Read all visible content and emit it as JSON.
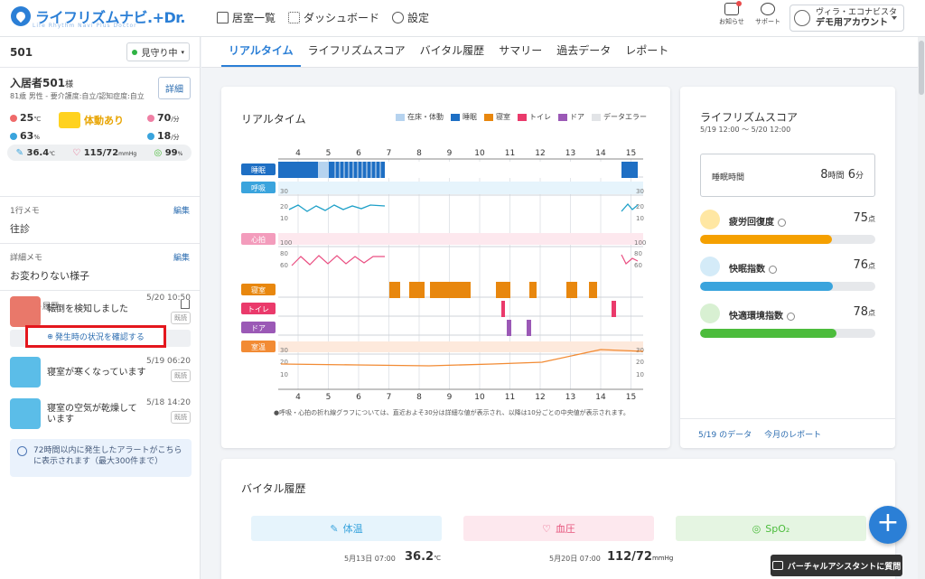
{
  "brand": {
    "name": "ライフリズムナビ.+Dr.",
    "tagline": "Life Rhythm Navi Plus Doctor",
    "accent": "#2b7fd6"
  },
  "topnav": [
    {
      "label": "居室一覧",
      "icon": "home-icon"
    },
    {
      "label": "ダッシュボード",
      "icon": "dashboard-icon"
    },
    {
      "label": "設定",
      "icon": "gear-icon"
    }
  ],
  "header": {
    "notifications_label": "お知らせ",
    "support_label": "サポート"
  },
  "account": {
    "facility": "ヴィラ・エコナビスタ",
    "name": "デモ用アカウント"
  },
  "sidebar": {
    "room_no": "501",
    "watch_status": "見守り中",
    "resident": {
      "name": "入居者501",
      "suffix": "様",
      "info": "81歳 男性 - 要介護度:自立/認知症度:自立",
      "detail_label": "詳細"
    },
    "env": {
      "temp": "25",
      "temp_unit": "℃",
      "humidity": "63",
      "humidity_unit": "%",
      "activity": "体動あり",
      "heart": "70",
      "heart_unit": "/分",
      "resp": "18",
      "resp_unit": "/分"
    },
    "vitals": {
      "body_temp": "36.4",
      "body_temp_unit": "℃",
      "bp": "115/72",
      "bp_unit": "mmHg",
      "spo2": "99",
      "spo2_unit": "%"
    },
    "memo1": {
      "label": "1行メモ",
      "edit": "編集",
      "value": "往診"
    },
    "memo2": {
      "label": "詳細メモ",
      "edit": "編集",
      "value": "お変わりない様子"
    },
    "alerts_label": "アラート履歴",
    "alerts": [
      {
        "text": "転倒を検知しました",
        "time": "5/20 10:50",
        "badge": "既読",
        "color": "#e9786a"
      },
      {
        "text": "寝室が寒くなっています",
        "time": "5/19 06:20",
        "badge": "既読",
        "color": "#5bbde8"
      },
      {
        "text": "寝室の空気が乾燥しています",
        "time": "5/18 14:20",
        "badge": "既読",
        "color": "#5bbde8"
      }
    ],
    "confirm_link": "発生時の状況を確認する",
    "info": "72時間以内に発生したアラートがこちらに表示されます（最大300件まで）"
  },
  "tabs": [
    "リアルタイム",
    "ライフリズムスコア",
    "バイタル履歴",
    "サマリー",
    "過去データ",
    "レポート"
  ],
  "realtime": {
    "title": "リアルタイム",
    "legend": [
      {
        "label": "在床・体動",
        "color": "#b6d3ef"
      },
      {
        "label": "睡眠",
        "color": "#1e6fc4"
      },
      {
        "label": "寝室",
        "color": "#e8870e"
      },
      {
        "label": "トイレ",
        "color": "#ea3a6b"
      },
      {
        "label": "ドア",
        "color": "#9b59b6"
      },
      {
        "label": "データエラー",
        "color": "#e2e4e7"
      }
    ],
    "hours": [
      "4",
      "5",
      "6",
      "7",
      "8",
      "9",
      "10",
      "11",
      "12",
      "13",
      "14",
      "15"
    ],
    "rows": [
      {
        "label": "睡眠",
        "color": "#1e6fc4"
      },
      {
        "label": "呼吸",
        "color": "#3aa4dd"
      },
      {
        "label": "心拍",
        "color": "#f39cbc"
      },
      {
        "label": "寝室",
        "color": "#e8870e"
      },
      {
        "label": "トイレ",
        "color": "#ea3a6b"
      },
      {
        "label": "ドア",
        "color": "#9b59b6"
      },
      {
        "label": "室温",
        "color": "#f28b34"
      }
    ],
    "scale": {
      "resp": [
        "30",
        "20",
        "10"
      ],
      "heart": [
        "100",
        "80",
        "60"
      ],
      "temp": [
        "30",
        "20",
        "10"
      ]
    },
    "note": "●呼吸・心拍の折れ線グラフについては、直近およそ30分は詳細な値が表示され、以降は10分ごとの中央値が表示されます。"
  },
  "score": {
    "title": "ライフリズムスコア",
    "range": "5/19 12:00 〜 5/20 12:00",
    "sleep_label": "睡眠時間",
    "sleep_hours": "8",
    "sleep_hours_unit": "時間",
    "sleep_minutes": "6",
    "sleep_minutes_unit": "分",
    "metrics": [
      {
        "name": "疲労回復度",
        "value": "75",
        "unit": "点",
        "fraction": 0.75,
        "color": "#f5a000",
        "icon_bg": "#ffe7a3"
      },
      {
        "name": "快眠指数",
        "value": "76",
        "unit": "点",
        "fraction": 0.76,
        "color": "#3aa4dd",
        "icon_bg": "#d4ebf8"
      },
      {
        "name": "快適環境指数",
        "value": "78",
        "unit": "点",
        "fraction": 0.78,
        "color": "#4cbc3c",
        "icon_bg": "#d8f0d2"
      }
    ],
    "links": [
      "5/19 のデータ",
      "今月のレポート"
    ]
  },
  "vital_history": {
    "title": "バイタル履歴",
    "tiles": [
      {
        "label": "体温",
        "bg": "#e6f4fc",
        "color": "#3aa4dd"
      },
      {
        "label": "血圧",
        "bg": "#fde8ee",
        "color": "#e6527b"
      },
      {
        "label": "SpO₂",
        "bg": "#e5f5e2",
        "color": "#4cbc3c"
      }
    ],
    "readings": [
      {
        "date": "5月13日 07:00",
        "value": "36.2",
        "unit": "℃"
      },
      {
        "date": "5月20日 07:00",
        "value": "112/72",
        "unit": "mmHg"
      }
    ]
  },
  "assistant_label": "バーチャルアシスタントに質問"
}
